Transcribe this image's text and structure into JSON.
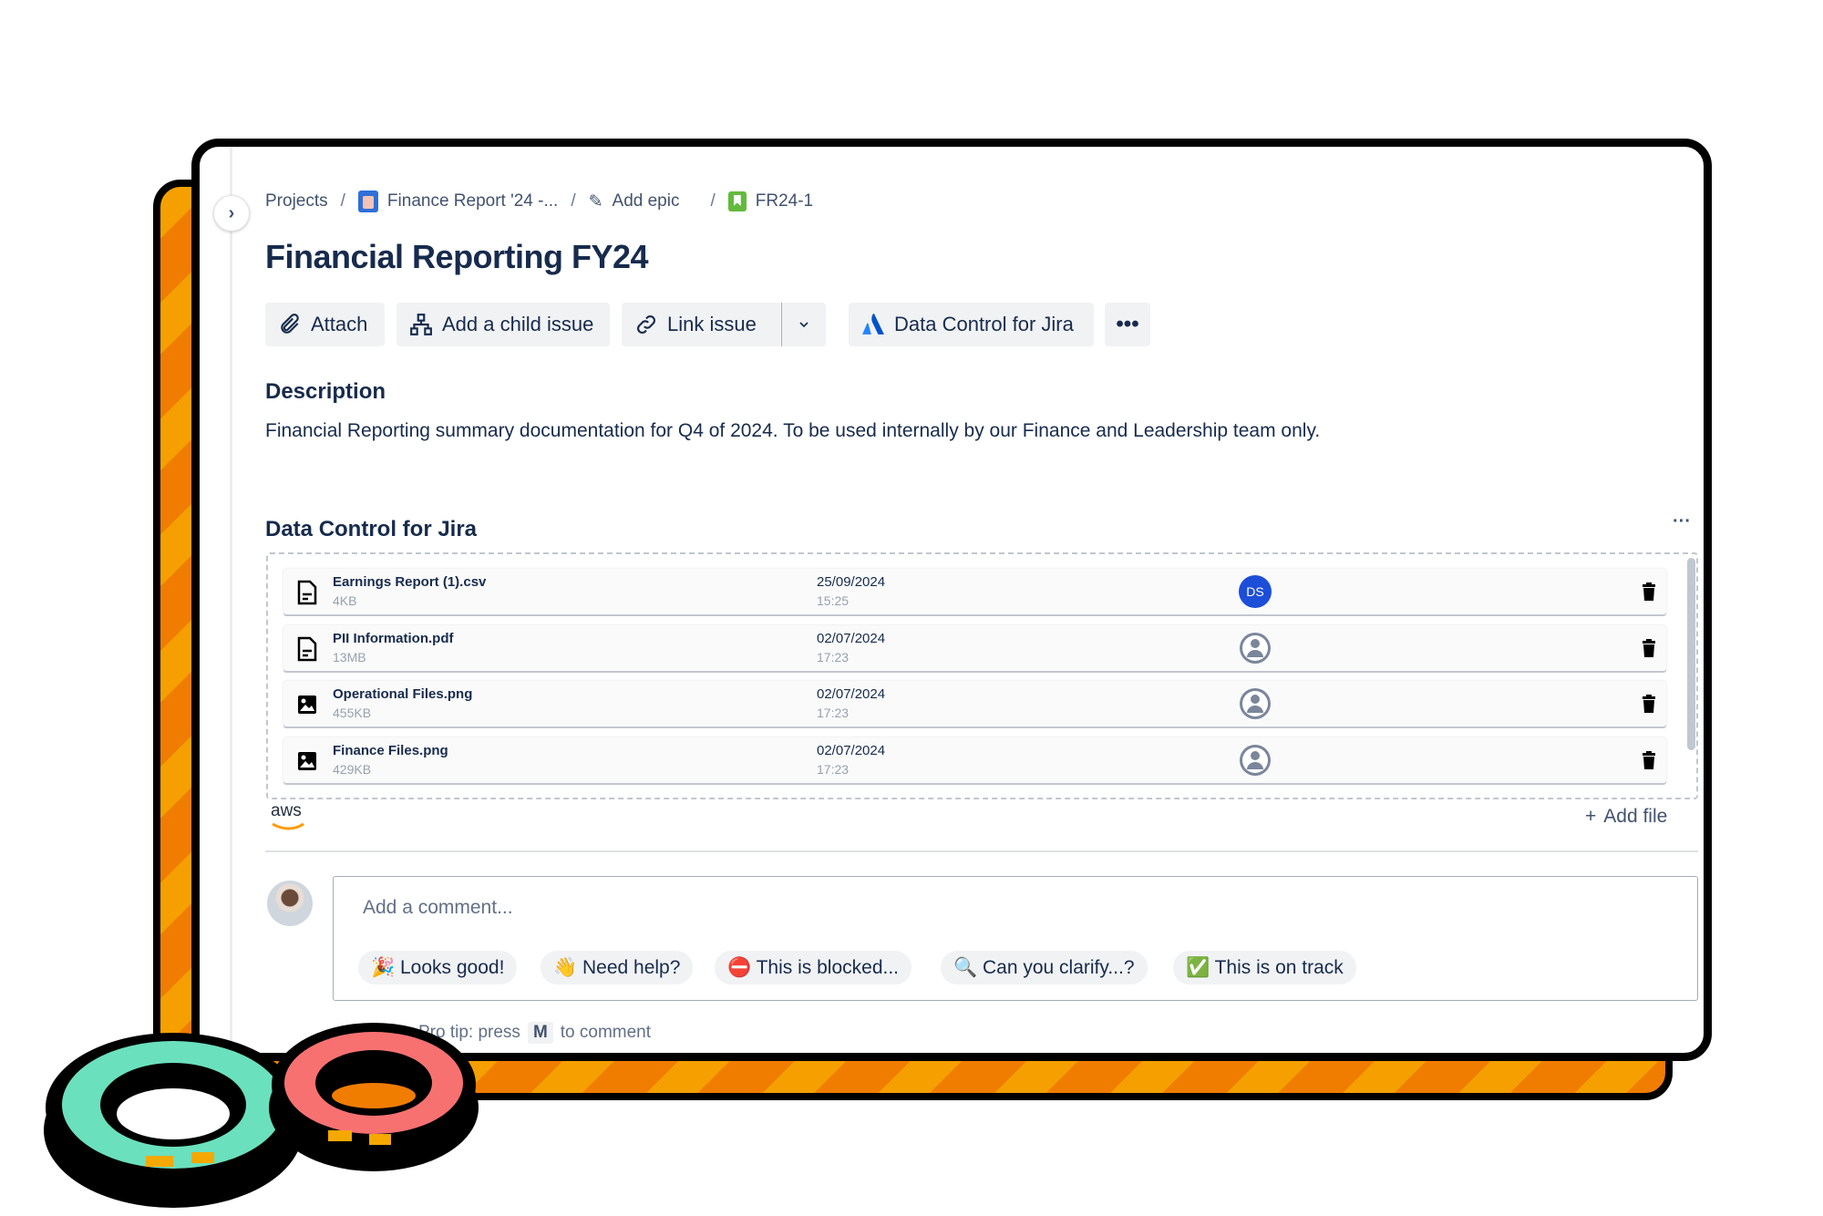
{
  "breadcrumb": {
    "projects": "Projects",
    "project": "Finance Report '24 -...",
    "epic": "Add epic",
    "issue_key": "FR24-1"
  },
  "title": "Financial Reporting FY24",
  "toolbar": {
    "attach": "Attach",
    "add_child": "Add a child issue",
    "link_issue": "Link issue",
    "data_control": "Data Control for Jira"
  },
  "description": {
    "heading": "Description",
    "text": "Financial Reporting summary documentation for Q4 of 2024. To be used internally by our Finance and Leadership team only."
  },
  "data_control": {
    "heading": "Data Control for Jira",
    "files": [
      {
        "name": "Earnings Report (1).csv",
        "size": "4KB",
        "date": "25/09/2024",
        "time": "15:25",
        "type": "document",
        "uploader": "DS"
      },
      {
        "name": "PII Information.pdf",
        "size": "13MB",
        "date": "02/07/2024",
        "time": "17:23",
        "type": "document",
        "uploader": ""
      },
      {
        "name": "Operational Files.png",
        "size": "455KB",
        "date": "02/07/2024",
        "time": "17:23",
        "type": "image",
        "uploader": ""
      },
      {
        "name": "Finance Files.png",
        "size": "429KB",
        "date": "02/07/2024",
        "time": "17:23",
        "type": "image",
        "uploader": ""
      }
    ],
    "storage_logo": "aws",
    "add_file": "Add file"
  },
  "comment": {
    "placeholder": "Add a comment...",
    "quick_replies": [
      "🎉 Looks good!",
      "👋 Need help?",
      "⛔ This is blocked...",
      "🔍 Can you clarify...?",
      "✅ This is on track"
    ],
    "tip_prefix": "Pro tip: press",
    "tip_key": "M",
    "tip_suffix": "to comment"
  },
  "colors": {
    "accent": "#0c66e4",
    "avatar_ds": "#1d4ed8",
    "back_card_orange": "#f07d00",
    "gear_teal": "#6be0bd",
    "gear_red": "#f87171"
  }
}
